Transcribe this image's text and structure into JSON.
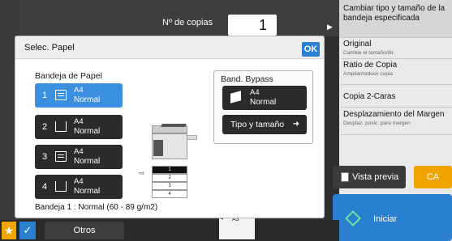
{
  "header": {
    "copies_label": "Nº de copias",
    "copies_value": "1"
  },
  "right_panel": {
    "items": [
      {
        "title": "Cambiar tipo y tamaño de la bandeja especificada",
        "subtitle": ""
      },
      {
        "title": "Original",
        "subtitle": "Cambie el tamaño/dir."
      },
      {
        "title": "Ratio de Copia",
        "subtitle": "Ampliar/reducir copia"
      },
      {
        "title": "Copia 2-Caras",
        "subtitle": ""
      },
      {
        "title": "Desplazamiento del Margen",
        "subtitle": "Desplaz. posic. para margen"
      }
    ],
    "preview_label": "Vista previa",
    "ca_label": "CA",
    "start_label": "Iniciar"
  },
  "dialog": {
    "title": "Selec. Papel",
    "ok_label": "OK",
    "trays_label": "Bandeja de Papel",
    "trays": [
      {
        "num": "1",
        "size": "A4",
        "type": "Normal",
        "selected": true
      },
      {
        "num": "2",
        "size": "A4",
        "type": "Normal",
        "selected": false
      },
      {
        "num": "3",
        "size": "A4",
        "type": "Normal",
        "selected": false
      },
      {
        "num": "4",
        "size": "A4",
        "type": "Normal",
        "selected": false
      }
    ],
    "bypass": {
      "title": "Band. Bypass",
      "size": "A4",
      "type": "Normal",
      "tipo_label": "Tipo y tamaño"
    },
    "status": "Bandeja 1 : Normal (60 - 89 g/m2)",
    "machine_trays": [
      "1",
      "2",
      "3",
      "4"
    ]
  },
  "bottom": {
    "otros_label": "Otros",
    "mini_tray_num": "4",
    "mini_tray_size": "A3"
  }
}
